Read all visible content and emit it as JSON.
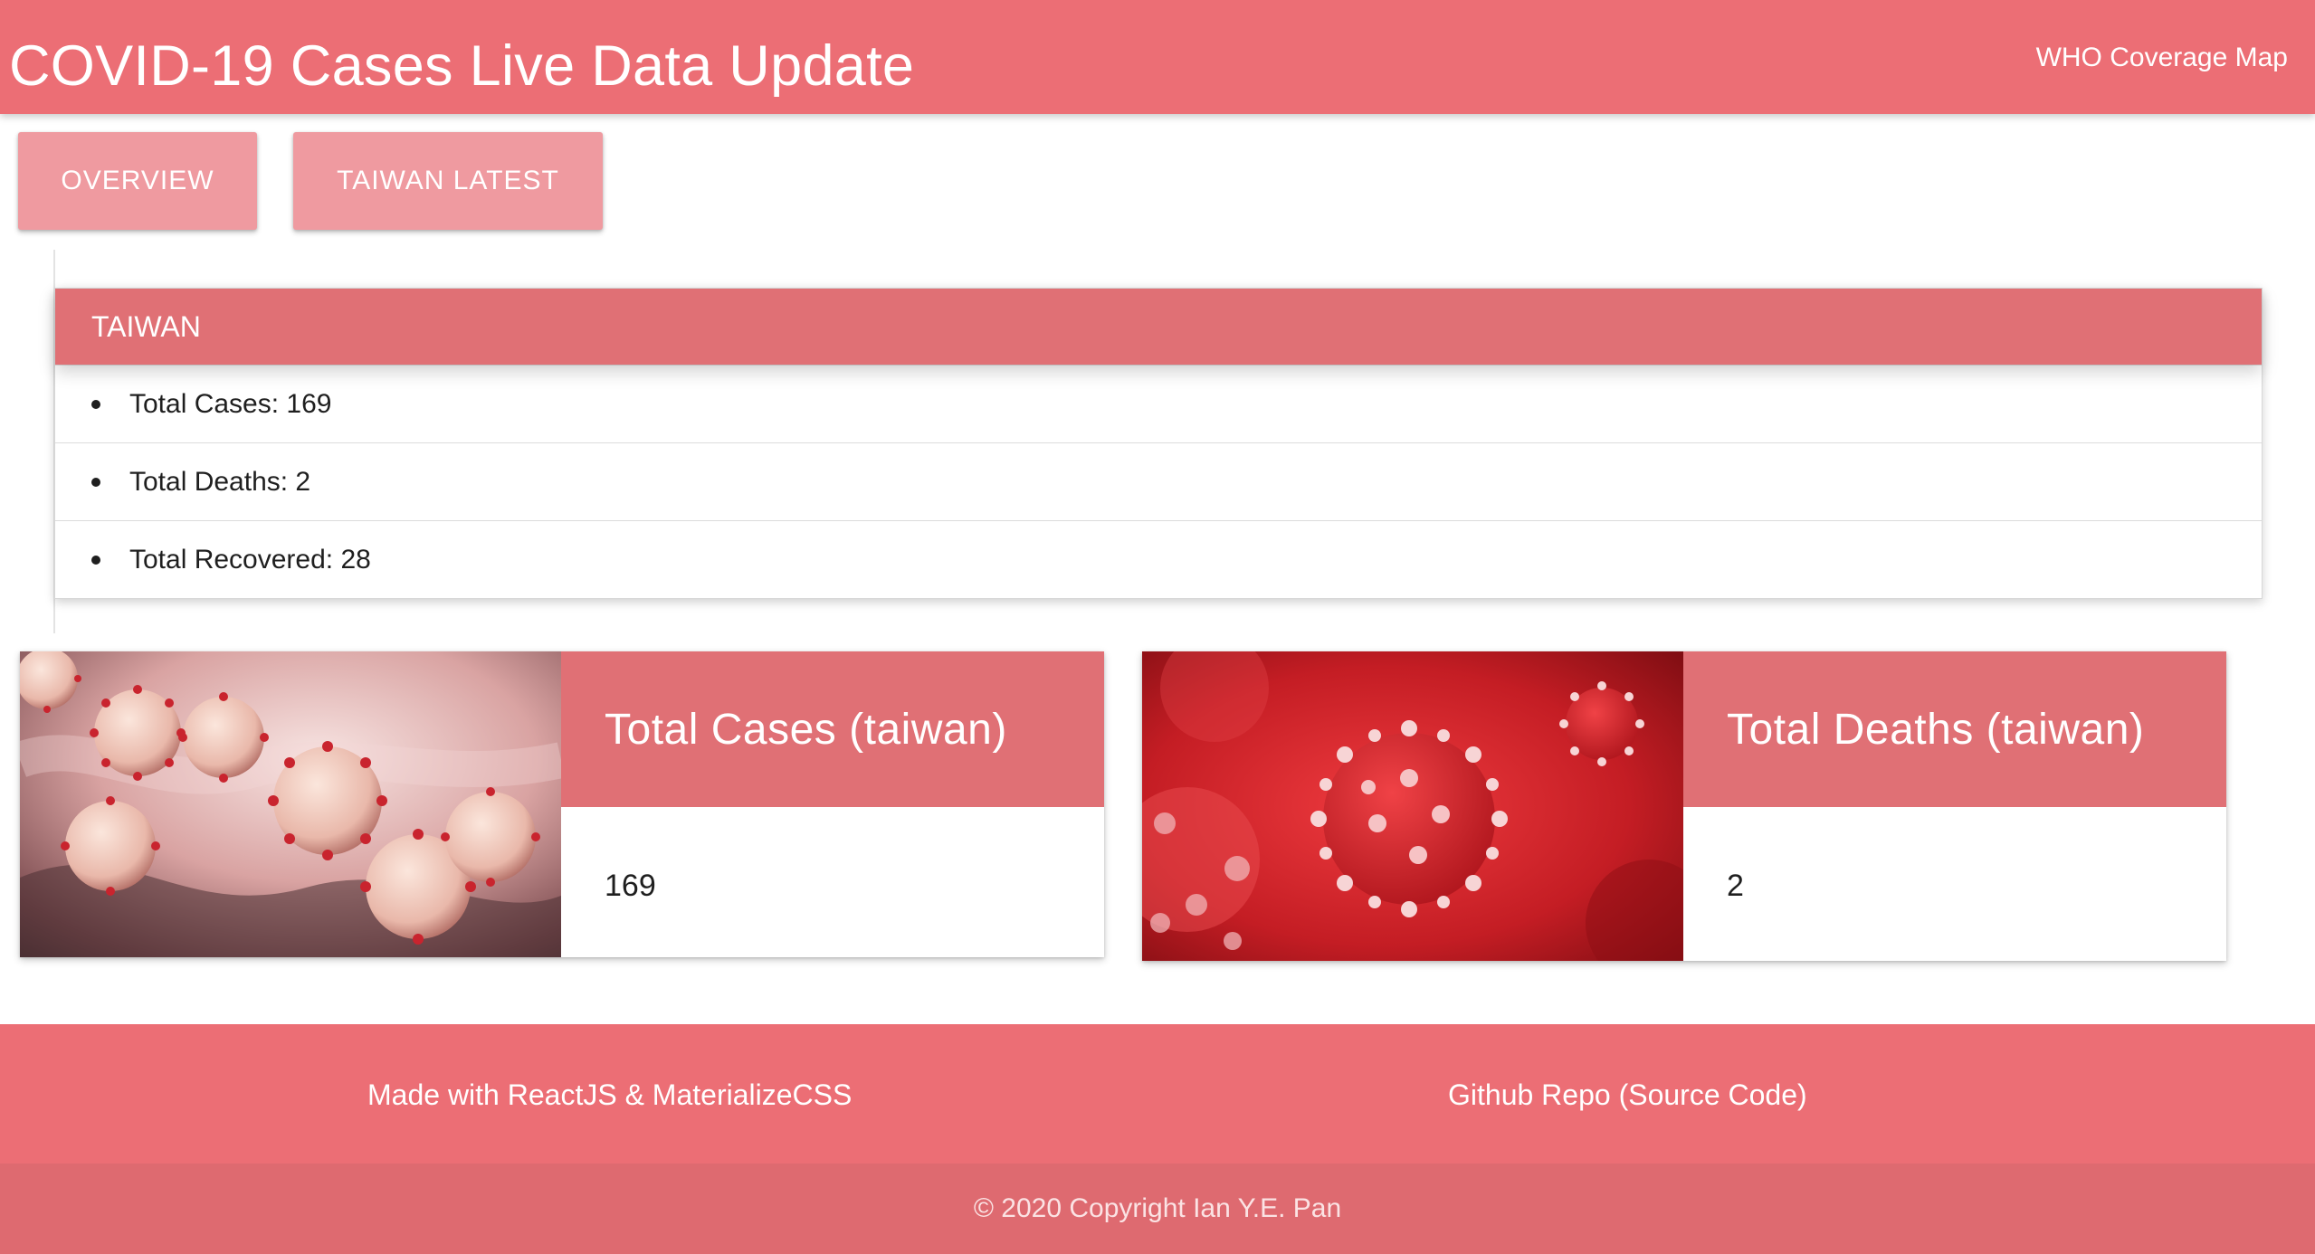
{
  "navbar": {
    "brand": "COVID-19 Cases Live Data Update",
    "link": "WHO Coverage Map",
    "bg_color": "#ec6e75"
  },
  "tabs": [
    {
      "label": "OVERVIEW"
    },
    {
      "label": "TAIWAN LATEST"
    }
  ],
  "country_panel": {
    "header": "TAIWAN",
    "items": [
      {
        "label": "Total Cases: 169"
      },
      {
        "label": "Total Deaths: 2"
      },
      {
        "label": "Total Recovered: 28"
      }
    ]
  },
  "cards": [
    {
      "title": "Total Cases (taiwan)",
      "value": "169",
      "image_icon": "coronavirus-image"
    },
    {
      "title": "Total Deaths (taiwan)",
      "value": "2",
      "image_icon": "coronavirus-image"
    }
  ],
  "footer": {
    "made_with": "Made with ReactJS & MaterializeCSS",
    "repo": "Github Repo (Source Code)",
    "copyright": "© 2020 Copyright Ian Y.E. Pan"
  },
  "colors": {
    "primary": "#ec6e75",
    "header": "#e07075",
    "button": "#ef9aa0",
    "footer_copyright": "#de6a70"
  }
}
